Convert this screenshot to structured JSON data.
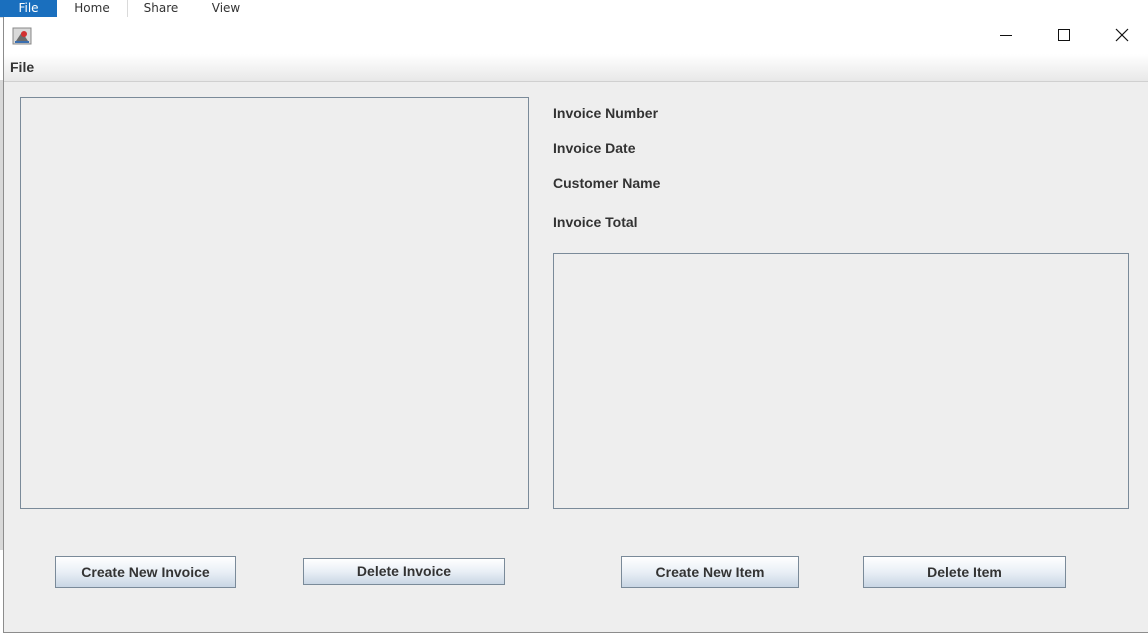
{
  "background_ribbon": {
    "tabs": [
      "File",
      "Home",
      "Share",
      "View"
    ]
  },
  "menu": {
    "file_label": "File"
  },
  "invoice_details": {
    "number_label": "Invoice Number",
    "date_label": "Invoice Date",
    "customer_label": "Customer Name",
    "total_label": "Invoice Total"
  },
  "buttons": {
    "create_invoice": "Create New Invoice",
    "delete_invoice": "Delete Invoice",
    "create_item": "Create New Item",
    "delete_item": "Delete Item"
  },
  "icons": {
    "app": "java-app-icon",
    "minimize": "minimize-icon",
    "maximize": "maximize-icon",
    "close": "close-icon"
  },
  "colors": {
    "ribbon_file_tab": "#1a6fbe",
    "window_bg": "#eeeeee",
    "panel_border": "#7a8a99"
  }
}
